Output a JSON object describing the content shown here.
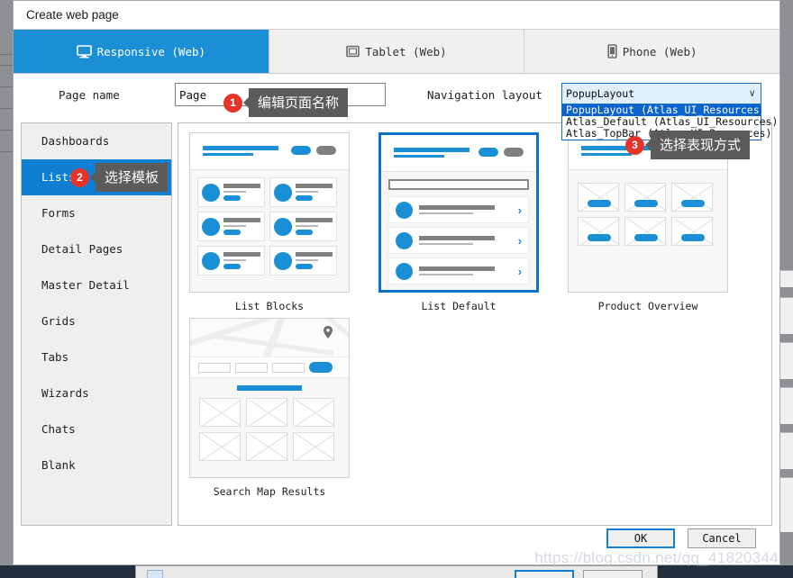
{
  "dialog": {
    "title": "Create web page"
  },
  "tabs": [
    {
      "label": "Responsive (Web)",
      "icon": "monitor-icon",
      "active": true
    },
    {
      "label": "Tablet (Web)",
      "icon": "tablet-icon",
      "active": false
    },
    {
      "label": "Phone (Web)",
      "icon": "phone-icon",
      "active": false
    }
  ],
  "form": {
    "page_name_label": "Page name",
    "page_name_value": "Page",
    "page_name_placeholder": "Page",
    "nav_layout_label": "Navigation layout",
    "nav_layout_value": "PopupLayout (Atlas_UI_Resources)",
    "nav_layout_options": [
      "PopupLayout (Atlas_UI_Resources)",
      "Atlas_Default (Atlas_UI_Resources)",
      "Atlas_TopBar (Atlas_UI_Resources)"
    ],
    "nav_layout_selected_index": 0,
    "caret": "∨"
  },
  "sidebar": {
    "items": [
      {
        "label": "Dashboards",
        "active": false
      },
      {
        "label": "Lists",
        "active": true
      },
      {
        "label": "Forms",
        "active": false
      },
      {
        "label": "Detail Pages",
        "active": false
      },
      {
        "label": "Master Detail",
        "active": false
      },
      {
        "label": "Grids",
        "active": false
      },
      {
        "label": "Tabs",
        "active": false
      },
      {
        "label": "Wizards",
        "active": false
      },
      {
        "label": "Chats",
        "active": false
      },
      {
        "label": "Blank",
        "active": false
      }
    ]
  },
  "templates": [
    {
      "caption": "List Blocks",
      "selected": false,
      "kind": "list-blocks"
    },
    {
      "caption": "List Default",
      "selected": true,
      "kind": "list-default"
    },
    {
      "caption": "Product Overview",
      "selected": false,
      "kind": "product-overview"
    },
    {
      "caption": "Search Map Results",
      "selected": false,
      "kind": "search-map-results"
    }
  ],
  "footer": {
    "ok_label": "OK",
    "cancel_label": "Cancel"
  },
  "callouts": [
    {
      "number": "1",
      "text": "编辑页面名称"
    },
    {
      "number": "2",
      "text": "选择模板"
    },
    {
      "number": "3",
      "text": "选择表现方式"
    }
  ],
  "watermark": "https://blog.csdn.net/qq_41820344",
  "colors": {
    "accent_blue": "#1a8fd6",
    "tab_active_blue": "#1a8fd6",
    "sidebar_active_blue": "#0f7fd4",
    "dropdown_highlight": "#0b63ce",
    "selected_border": "#0d73c8",
    "badge_red": "#e8332a",
    "bubble_gray": "#5b5b5b",
    "gray_pill": "#808080"
  }
}
